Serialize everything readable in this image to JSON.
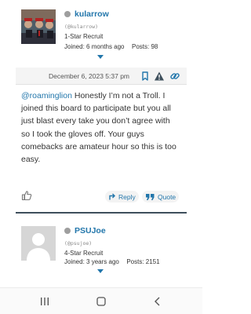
{
  "users": [
    {
      "username": "kularrow",
      "handle": "(@kularrow)",
      "rank": "1-Star Recruit",
      "joined_label": "Joined:",
      "joined_value": "6 months ago",
      "posts_label": "Posts:",
      "posts_value": "98"
    },
    {
      "username": "PSUJoe",
      "handle": "(@psujoe)",
      "rank": "4-Star Recruit",
      "joined_label": "Joined:",
      "joined_value": "3 years ago",
      "posts_label": "Posts:",
      "posts_value": "2151"
    }
  ],
  "post": {
    "date": "December 6, 2023 5:37 pm",
    "mention": "@roaminglion",
    "body": " Honestly I’m not a Troll. I joined this board to participate but you all just blast every take you don’t agree with so I took the gloves off. Your guys comebacks are amateur hour so this is too easy."
  },
  "actions": {
    "reply_label": "Reply",
    "quote_label": "Quote"
  },
  "icons": {
    "bookmark": "bookmark-icon",
    "report": "warning-icon",
    "link": "link-icon",
    "like": "thumbs-up-icon",
    "reply": "reply-arrow-icon",
    "quote": "quote-icon"
  },
  "colors": {
    "link_blue": "#2276ab",
    "divider": "#3e4f5c",
    "status_gray": "#9e9e9e"
  }
}
